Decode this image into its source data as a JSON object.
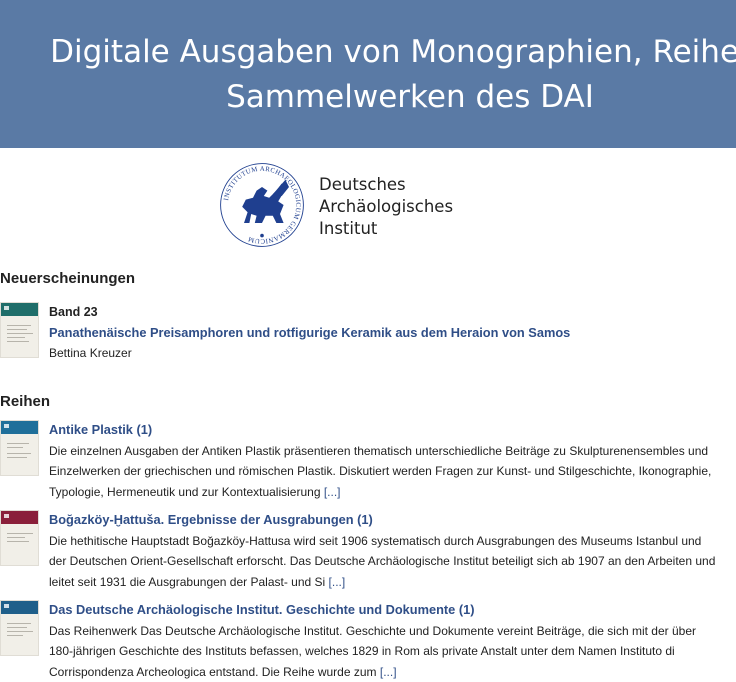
{
  "banner": {
    "title_line1": "Digitale Ausgaben von Monographien, Reihen-",
    "title_line2": "Sammelwerken des DAI",
    "color": "#5a7aa5"
  },
  "logo": {
    "seal_text": "INSTITUTUM ARCHAEOLOGICUM GERMANICUM",
    "name_lines": [
      "Deutsches",
      "Archäologisches",
      "Institut"
    ]
  },
  "new_releases": {
    "heading": "Neuerscheinungen",
    "items": [
      {
        "band": "Band 23",
        "title": "Panathenäische Preisamphoren und rotfigurige Keramik aus dem Heraion von Samos",
        "author": "Bettina Kreuzer"
      }
    ]
  },
  "series": {
    "heading": "Reihen",
    "items": [
      {
        "title": "Antike Plastik (1)",
        "desc_lines": [
          "Die einzelnen Ausgaben der Antiken Plastik präsentieren thematisch unterschiedliche Beiträge zu Skulpturenensembles und",
          "Einzelwerken der griechischen und römischen Plastik. Diskutiert werden Fragen zur Kunst- und Stilgeschichte, Ikonographie,",
          "Typologie, Hermeneutik und zur Kontextualisierung"
        ],
        "more": "[...]",
        "cover_color": "#1f6f9a"
      },
      {
        "title": "Boğazköy-Ḫattuša. Ergebnisse der Ausgrabungen (1)",
        "desc_lines": [
          "Die hethitische Hauptstadt Boğazköy-Hattusa wird seit 1906 systematisch durch Ausgrabungen des Museums Istanbul und",
          "der Deutschen Orient-Gesellschaft erforscht. Das Deutsche Archäologische Institut beteiligt sich ab 1907 an den Arbeiten und",
          "leitet seit 1931 die Ausgrabungen der Palast- und Si"
        ],
        "more": "[...]",
        "cover_color": "#8a1f3a"
      },
      {
        "title": "Das Deutsche Archäologische Institut. Geschichte und Dokumente (1)",
        "desc_lines": [
          "Das Reihenwerk Das Deutsche Archäologische Institut. Geschichte und Dokumente vereint Beiträge, die sich mit der über",
          "180-jährigen Geschichte des Instituts befassen, welches 1829 in Rom als private Anstalt unter dem Namen Instituto di",
          "Corrispondenza Archeologica entstand. Die Reihe wurde zum"
        ],
        "more": "[...]",
        "cover_color": "#1f5f8a"
      }
    ]
  },
  "new_release_cover_color": "#1f6e6a"
}
